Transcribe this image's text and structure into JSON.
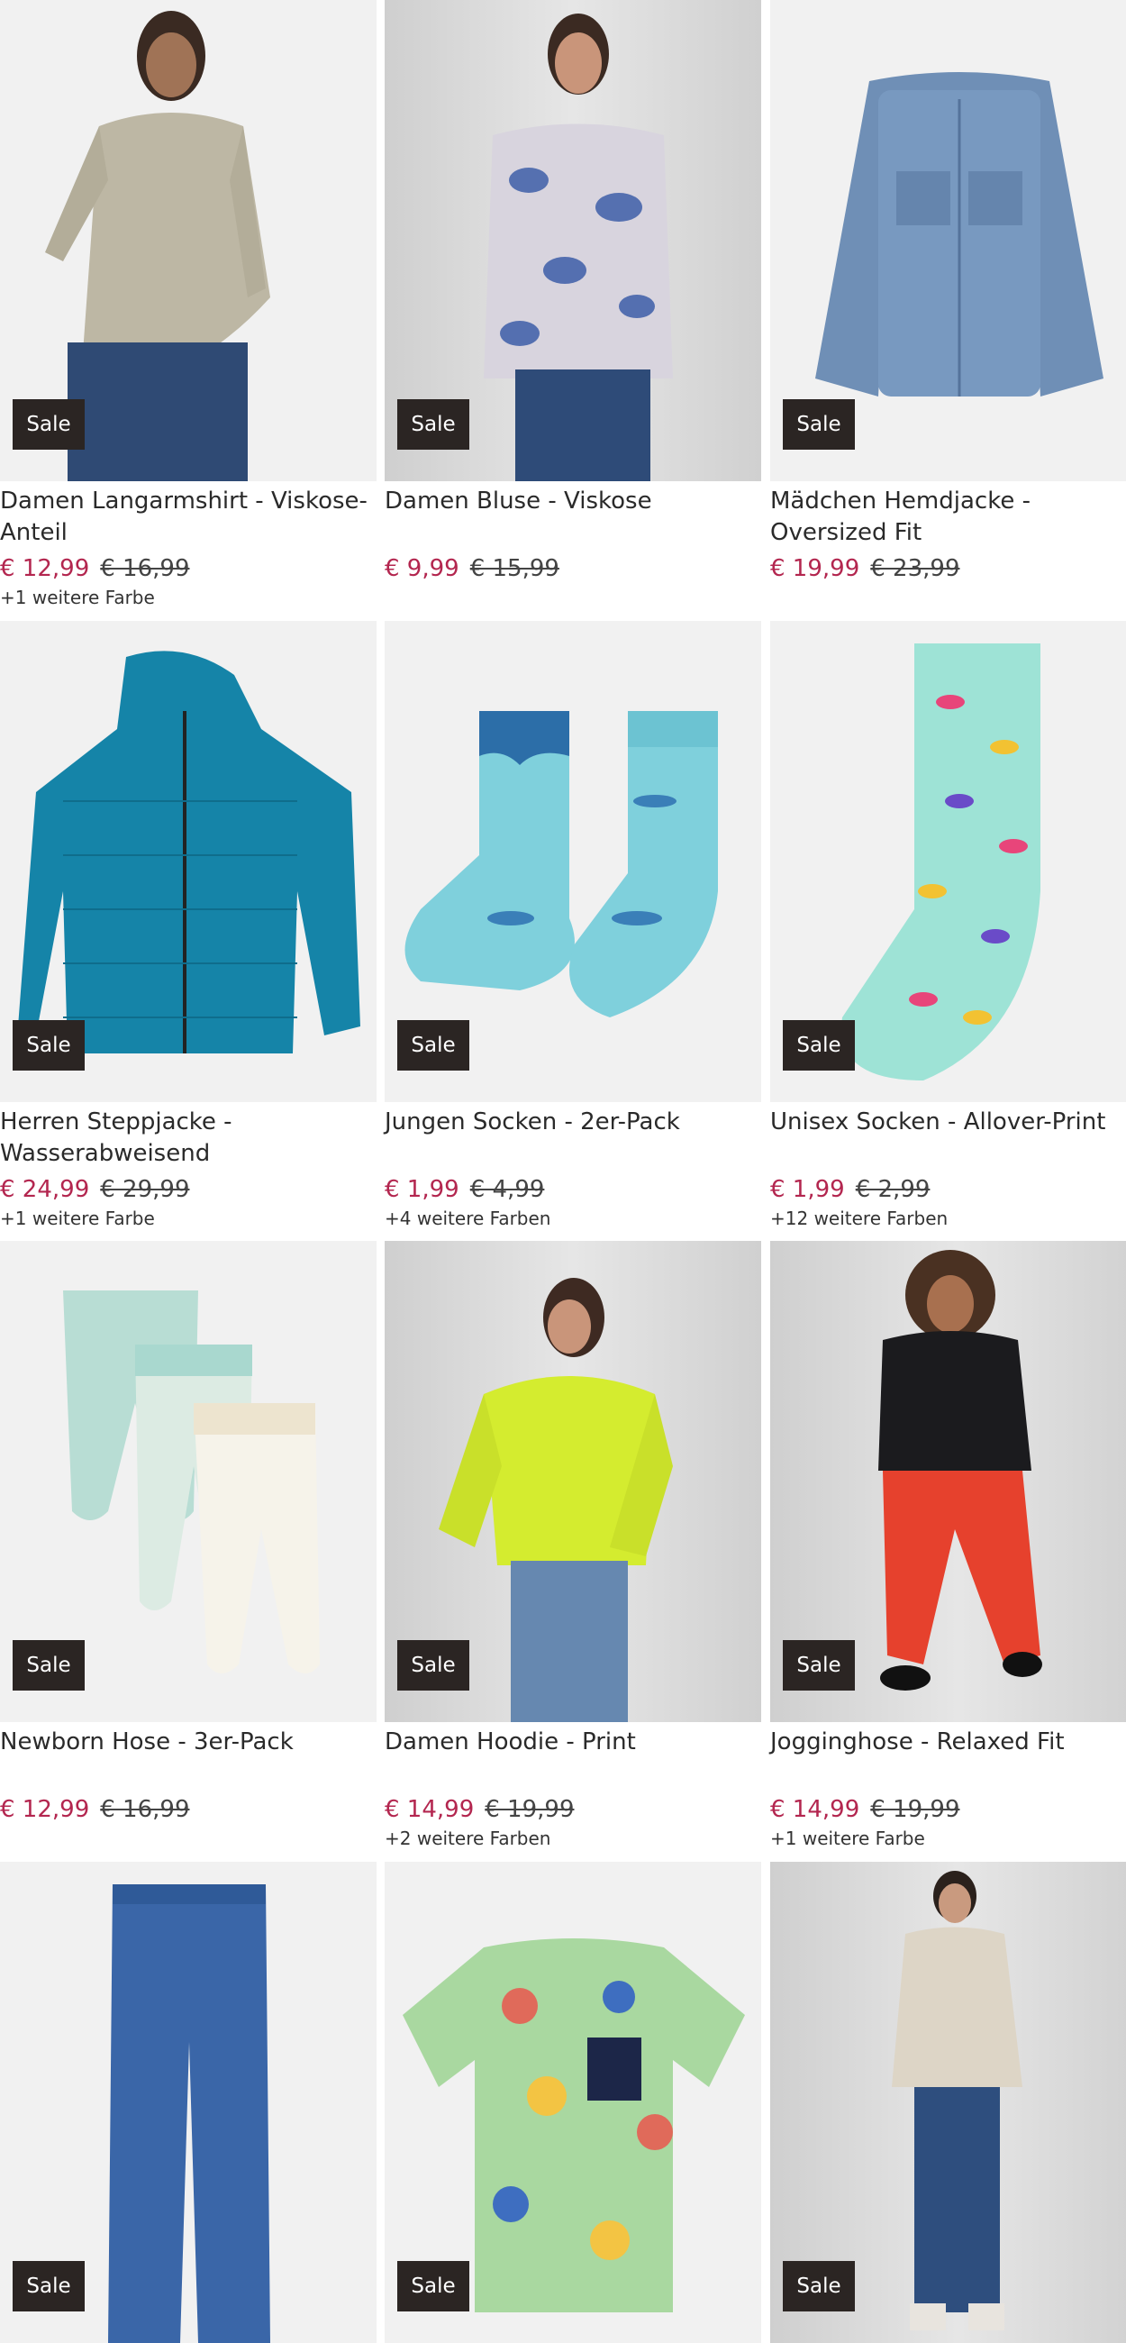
{
  "products": [
    {
      "title": "Damen Langarmshirt - Viskose-Anteil",
      "price": "€ 12,99",
      "old_price": "€ 16,99",
      "colors": "+1 weitere Farbe",
      "badge": "Sale",
      "image": "beige-tunic-woman"
    },
    {
      "title": "Damen Bluse - Viskose",
      "price": "€ 9,99",
      "old_price": "€ 15,99",
      "colors": "",
      "badge": "Sale",
      "image": "paisley-blouse-woman"
    },
    {
      "title": "Mädchen Hemdjacke - Oversized Fit",
      "price": "€ 19,99",
      "old_price": "€ 23,99",
      "colors": "",
      "badge": "Sale",
      "image": "denim-shirt-jacket"
    },
    {
      "title": "Herren Steppjacke - Wasserabweisend",
      "price": "€ 24,99",
      "old_price": "€ 29,99",
      "colors": "+1 weitere Farbe",
      "badge": "Sale",
      "image": "teal-puffer-jacket"
    },
    {
      "title": "Jungen Socken - 2er-Pack",
      "price": "€ 1,99",
      "old_price": "€ 4,99",
      "colors": "+4 weitere Farben",
      "badge": "Sale",
      "image": "shark-socks"
    },
    {
      "title": "Unisex Socken - Allover-Print",
      "price": "€ 1,99",
      "old_price": "€ 2,99",
      "colors": "+12 weitere Farben",
      "badge": "Sale",
      "image": "bird-print-sock"
    },
    {
      "title": "Newborn Hose - 3er-Pack",
      "price": "€ 12,99",
      "old_price": "€ 16,99",
      "colors": "",
      "badge": "Sale",
      "image": "baby-pants-set"
    },
    {
      "title": "Damen Hoodie - Print",
      "price": "€ 14,99",
      "old_price": "€ 19,99",
      "colors": "+2 weitere Farben",
      "badge": "Sale",
      "image": "lime-hoodie-woman"
    },
    {
      "title": "Jogginghose - Relaxed Fit",
      "price": "€ 14,99",
      "old_price": "€ 19,99",
      "colors": "+1 weitere Farbe",
      "badge": "Sale",
      "image": "red-joggers-woman"
    },
    {
      "title": "",
      "price": "",
      "old_price": "",
      "colors": "",
      "badge": "Sale",
      "image": "blue-jeans"
    },
    {
      "title": "",
      "price": "",
      "old_price": "",
      "colors": "",
      "badge": "Sale",
      "image": "floral-tshirt"
    },
    {
      "title": "",
      "price": "",
      "old_price": "",
      "colors": "",
      "badge": "Sale",
      "image": "quilted-jacket-woman"
    }
  ],
  "colors": {
    "price": "#b3264f",
    "badge_bg": "#2b2523"
  }
}
